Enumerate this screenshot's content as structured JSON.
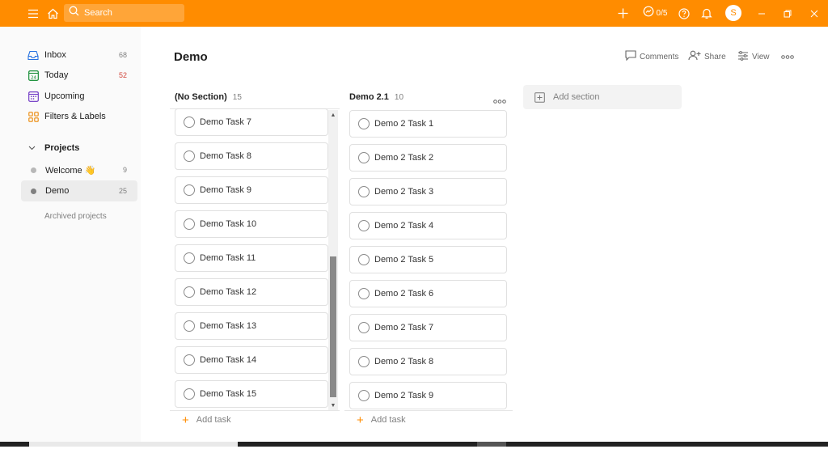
{
  "topbar": {
    "search_placeholder": "Search",
    "karma": "0/5",
    "avatar_initial": "S",
    "color": "#ff8c00"
  },
  "sidebar": {
    "nav": [
      {
        "label": "Inbox",
        "count": "68",
        "icon": "inbox-icon",
        "color": "#246fe0"
      },
      {
        "label": "Today",
        "count": "52",
        "icon": "calendar-today-icon",
        "color": "#058527",
        "count_color": "#d1453b"
      },
      {
        "label": "Upcoming",
        "count": "",
        "icon": "calendar-upcoming-icon",
        "color": "#692fc2"
      },
      {
        "label": "Filters & Labels",
        "count": "",
        "icon": "filters-icon",
        "color": "#eb8909"
      }
    ],
    "projects_title": "Projects",
    "projects": [
      {
        "label": "Welcome 👋",
        "count": "9",
        "dot_color": "#b8b8b8"
      },
      {
        "label": "Demo",
        "count": "25",
        "dot_color": "#808080"
      }
    ],
    "archived_label": "Archived projects"
  },
  "main": {
    "title": "Demo",
    "actions": {
      "comments": "Comments",
      "share": "Share",
      "view": "View"
    },
    "columns": [
      {
        "name": "(No Section)",
        "count": "15",
        "tasks": [
          "Demo Task 7",
          "Demo Task 8",
          "Demo Task 9",
          "Demo Task 10",
          "Demo Task 11",
          "Demo Task 12",
          "Demo Task 13",
          "Demo Task 14",
          "Demo Task 15"
        ],
        "add_task": "Add task"
      },
      {
        "name": "Demo 2.1",
        "count": "10",
        "tasks": [
          "Demo 2 Task 1",
          "Demo 2 Task 2",
          "Demo 2 Task 3",
          "Demo 2 Task 4",
          "Demo 2 Task 5",
          "Demo 2 Task 6",
          "Demo 2 Task 7",
          "Demo 2 Task 8",
          "Demo 2 Task 9"
        ],
        "add_task": "Add task"
      }
    ],
    "add_section": "Add section"
  }
}
